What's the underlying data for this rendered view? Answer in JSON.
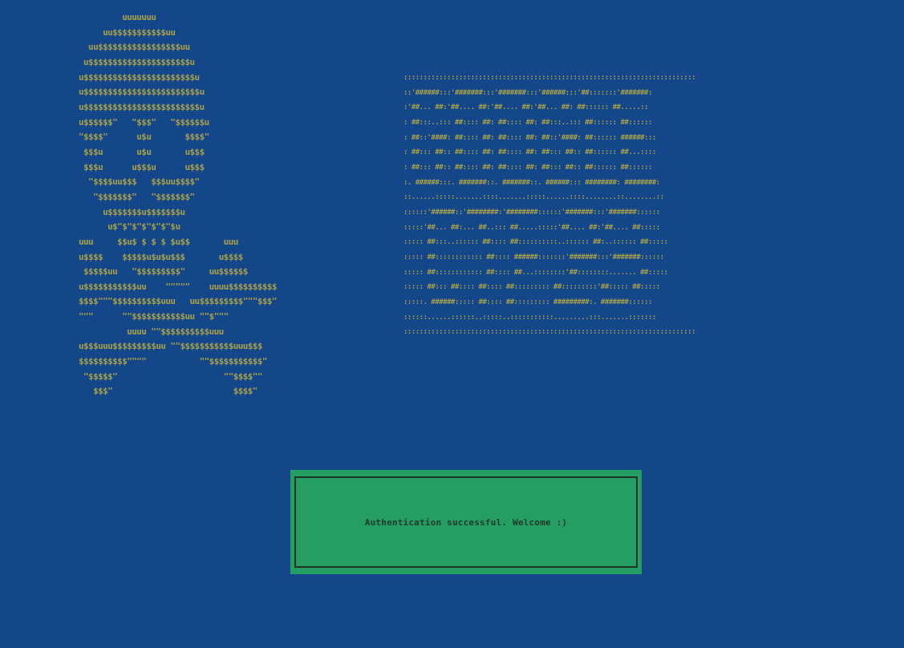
{
  "skull_art": "         uuuuuuu\n     uu$$$$$$$$$$$uu\n  uu$$$$$$$$$$$$$$$$$uu\n u$$$$$$$$$$$$$$$$$$$$$u\nu$$$$$$$$$$$$$$$$$$$$$$$u\nu$$$$$$$$$$$$$$$$$$$$$$$$u\nu$$$$$$$$$$$$$$$$$$$$$$$$u\nu$$$$$$\"   \"$$$\"   \"$$$$$$u\n\"$$$$\"      u$u       $$$$\"\n $$$u       u$u       u$$$\n $$$u      u$$$u      u$$$\n  \"$$$$uu$$$   $$$uu$$$$\"\n   \"$$$$$$$\"   \"$$$$$$$\"\n     u$$$$$$$u$$$$$$$u\n      u$\"$\"$\"$\"$\"$\"$u\nuuu     $$u$ $ $ $ $u$$       uuu\nu$$$$    $$$$$u$u$u$$$       u$$$$\n $$$$$uu   \"$$$$$$$$$\"     uu$$$$$$\nu$$$$$$$$$$$uu    \"\"\"\"\"    uuuu$$$$$$$$$$\n$$$$\"\"\"$$$$$$$$$$uuu   uu$$$$$$$$$\"\"\"$$$\"\n\"\"\"      \"\"$$$$$$$$$$$uu \"\"$\"\"\"\n          uuuu \"\"$$$$$$$$$$uuu\nu$$$uuu$$$$$$$$$uu \"\"$$$$$$$$$$$uuu$$$\n$$$$$$$$$$\"\"\"\"           \"\"$$$$$$$$$$$\"\n \"$$$$$\"                      \"\"$$$$\"\"\n   $$$\"                         $$$$\"",
  "banner_art": "::::::::::::::::::::::::::::::::::::::::::::::::::::::::::::::::::::::::::\n::'######:::'#######:::'#######:::'######:::'##:::::::'#######:\n:'##... ##:'##.... ##:'##.... ##:'##... ##: ##:::::: ##.....::\n: ##:::..::: ##:::: ##: ##:::: ##: ##:::..::: ##:::::: ##::::::\n: ##::'####: ##:::: ##: ##:::: ##: ##::'####: ##:::::: ######:::\n: ##::: ##:: ##:::: ##: ##:::: ##: ##::: ##:: ##:::::: ##...::::\n: ##::: ##:: ##:::: ##: ##:::: ##: ##::: ##:: ##:::::: ##::::::\n:. ######:::. #######::. #######::. ######::: ########: ########:\n::......:::::.......::::.......:::::......::::........::........::\n::::::'######::'########:'########::::::'#######:::'#######::::::\n:::::'##... ##:... ##..::: ##.....:::::'##.... ##:'##.... ##:::::\n::::: ##:::..:::::: ##:::: ##::::::::::..:::::: ##:..:::::: ##:::::\n::::: ##:::::::::::: ##:::: ######:::::::'#######:::'#######::::::\n::::: ##:::::::::::: ##:::: ##...::::::::'##::::::::....... ##:::::\n::::: ##::: ##:::: ##:::: ##::::::::: ##:::::::::'##::::: ##:::::\n:::::. ######::::: ##:::: ##::::::::: #########:. #######::::::\n::::::......::::::..:::::..:::::::::::.........:::.......:::::::\n::::::::::::::::::::::::::::::::::::::::::::::::::::::::::::::::::::::::::",
  "dialog": {
    "message": "Authentication successful. Welcome :)"
  },
  "colors": {
    "background": "#14478a",
    "ascii_art": "#a7a04a",
    "dialog_fill": "#249e63",
    "dialog_border": "#1c3326",
    "dialog_text": "#1f3a2c"
  }
}
